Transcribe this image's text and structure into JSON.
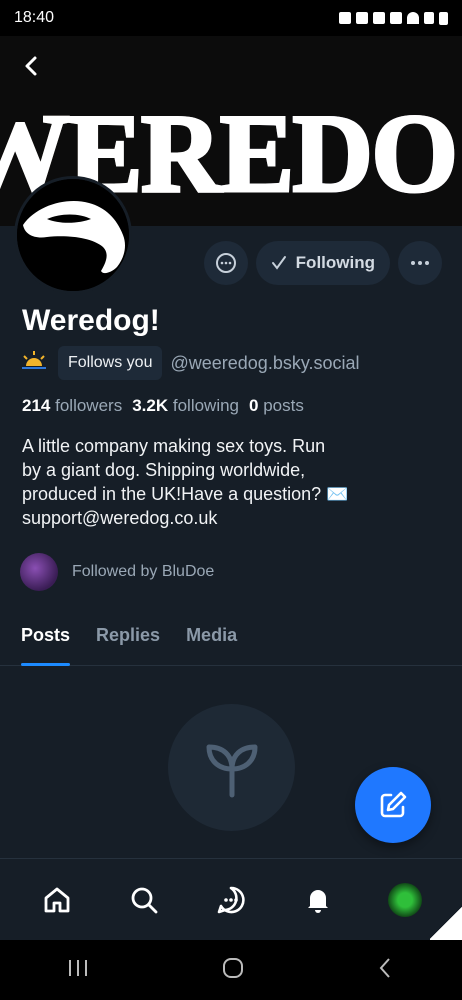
{
  "status_bar": {
    "time": "18:40"
  },
  "banner": {
    "text": "WEREDO"
  },
  "profile": {
    "name": "Weredog!",
    "follows_you": "Follows you",
    "handle": "@weeredog.bsky.social",
    "stats": {
      "followers_count": "214",
      "followers_label": "followers",
      "following_count": "3.2K",
      "following_label": "following",
      "posts_count": "0",
      "posts_label": "posts"
    },
    "bio_lines": [
      "A little company making sex toys. Run",
      "by a giant dog. Shipping worldwide,",
      "produced in the UK!Have a question? ✉️",
      "support@weredog.co.uk"
    ],
    "followed_by": "Followed by BluDoe"
  },
  "actions": {
    "following_label": "Following"
  },
  "tabs": [
    {
      "label": "Posts",
      "active": true
    },
    {
      "label": "Replies",
      "active": false
    },
    {
      "label": "Media",
      "active": false
    }
  ],
  "colors": {
    "accent": "#1f78ff",
    "background": "#161e27",
    "muted": "#9aa8b6"
  },
  "icons": {
    "back": "chevron-left-icon",
    "message": "chat-bubble-icon",
    "more": "ellipsis-icon",
    "empty": "sprout-icon",
    "compose": "pencil-square-icon",
    "nav": [
      "home-icon",
      "search-icon",
      "chat-icon",
      "bell-icon",
      "user-avatar"
    ]
  }
}
